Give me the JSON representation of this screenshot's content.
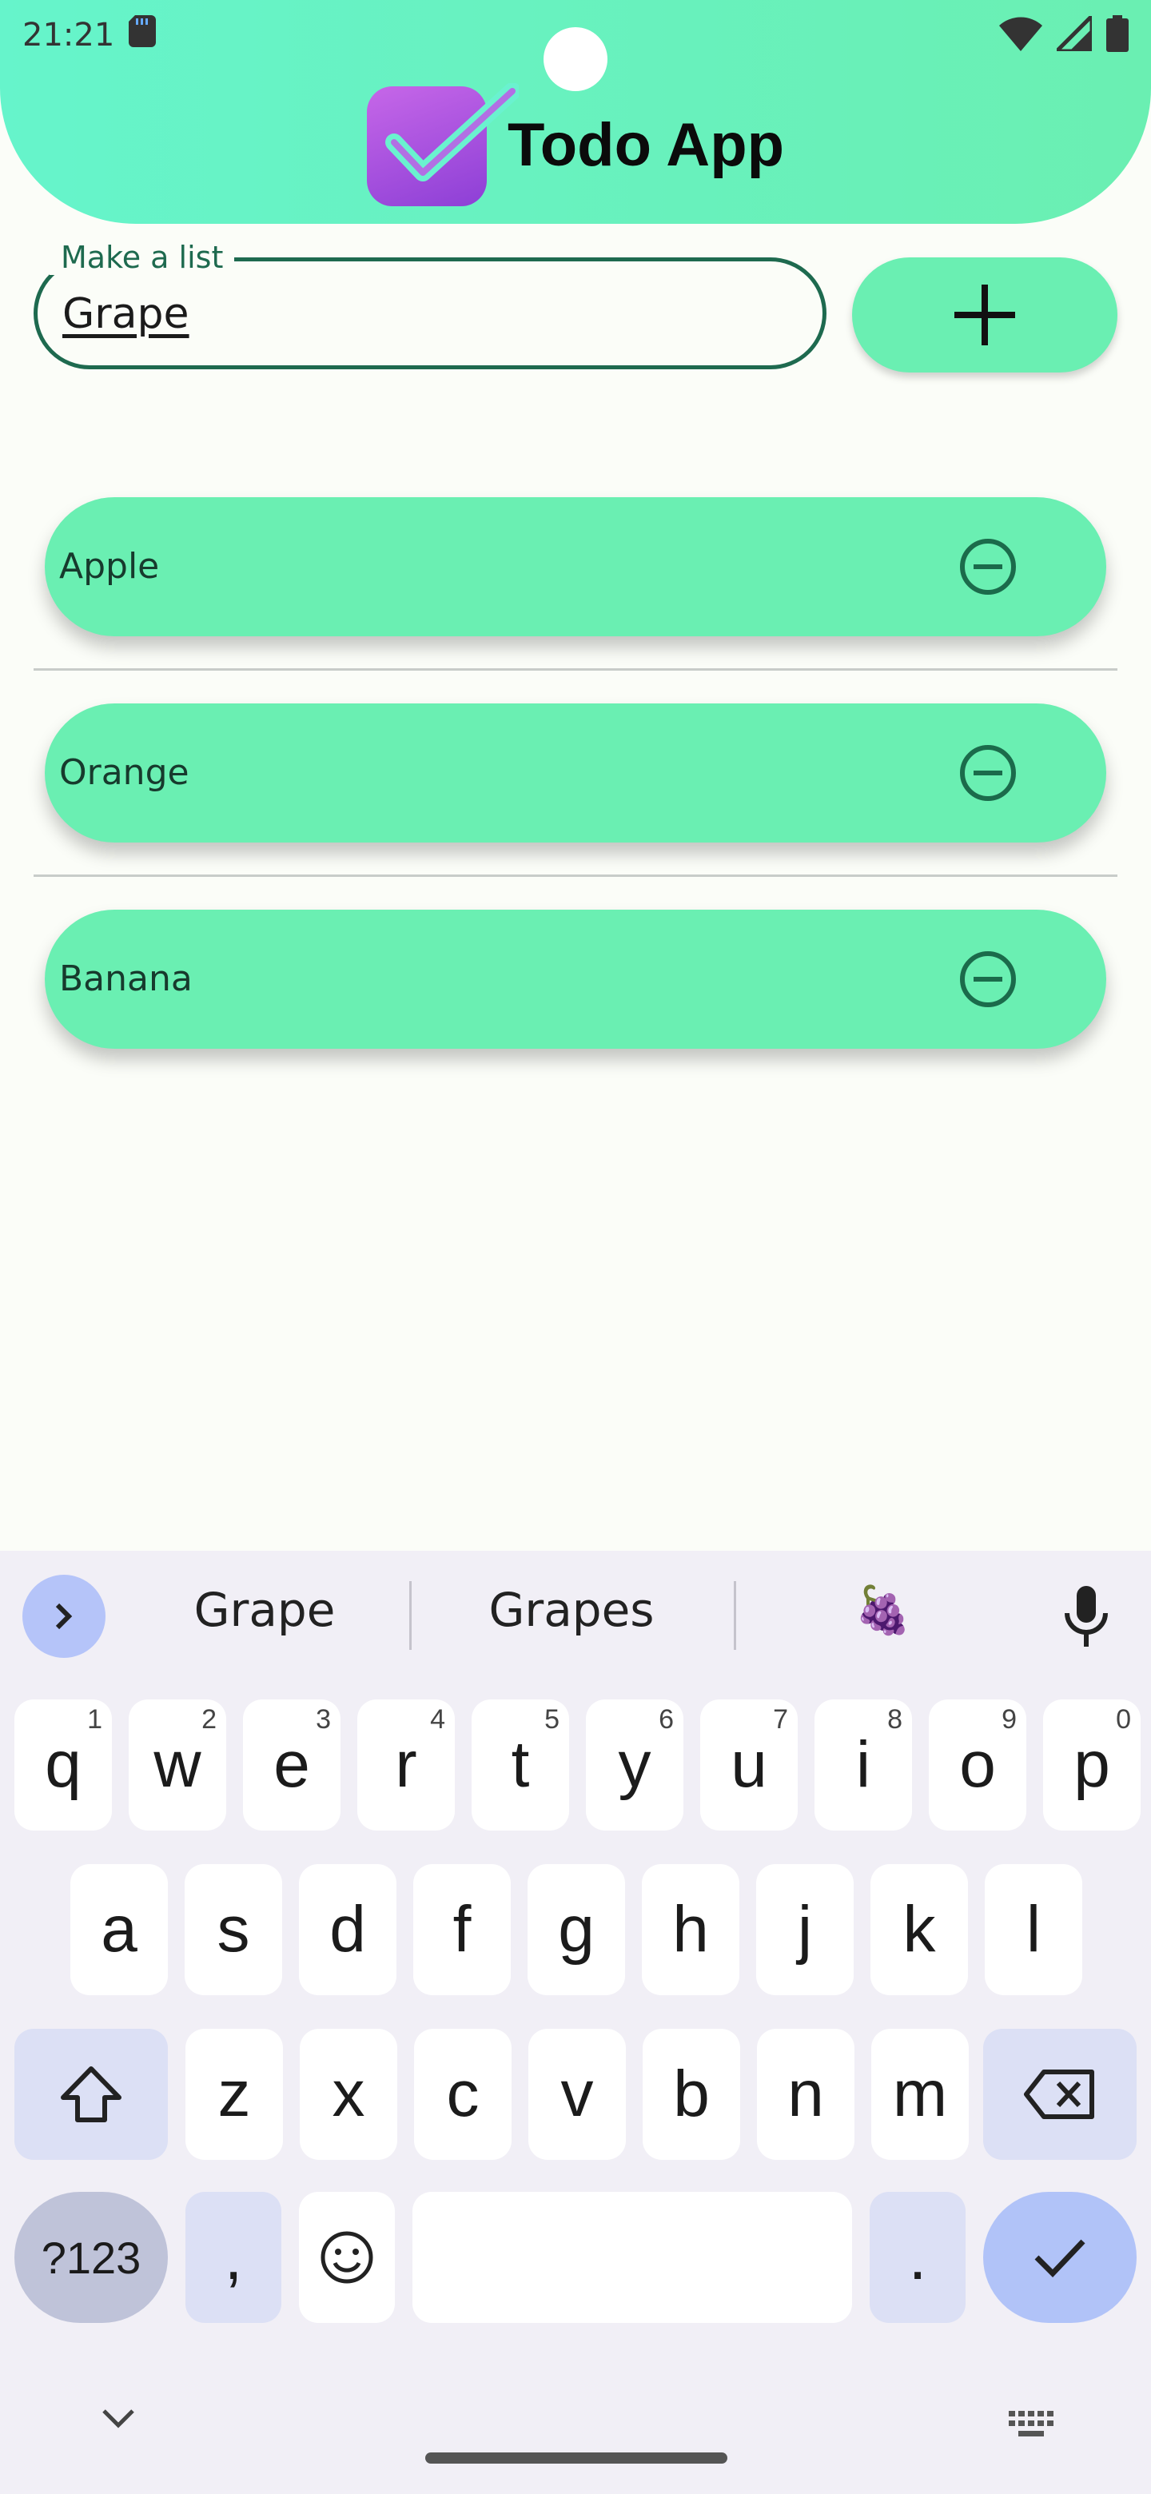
{
  "status_bar": {
    "time": "21:21"
  },
  "app": {
    "title": "Todo App"
  },
  "input": {
    "label": "Make a list",
    "value": "Grape"
  },
  "todos": [
    {
      "label": "Apple"
    },
    {
      "label": "Orange"
    },
    {
      "label": "Banana"
    }
  ],
  "keyboard": {
    "suggestions": [
      "Grape",
      "Grapes",
      "🍇"
    ],
    "row1": [
      {
        "k": "q",
        "h": "1"
      },
      {
        "k": "w",
        "h": "2"
      },
      {
        "k": "e",
        "h": "3"
      },
      {
        "k": "r",
        "h": "4"
      },
      {
        "k": "t",
        "h": "5"
      },
      {
        "k": "y",
        "h": "6"
      },
      {
        "k": "u",
        "h": "7"
      },
      {
        "k": "i",
        "h": "8"
      },
      {
        "k": "o",
        "h": "9"
      },
      {
        "k": "p",
        "h": "0"
      }
    ],
    "row2": [
      "a",
      "s",
      "d",
      "f",
      "g",
      "h",
      "j",
      "k",
      "l"
    ],
    "row3": [
      "z",
      "x",
      "c",
      "v",
      "b",
      "n",
      "m"
    ],
    "symbols_label": "?123",
    "comma": ",",
    "period": "."
  },
  "colors": {
    "accent": "#6aefb2",
    "border": "#1e6a4f",
    "logo": "#9b4fdd"
  }
}
